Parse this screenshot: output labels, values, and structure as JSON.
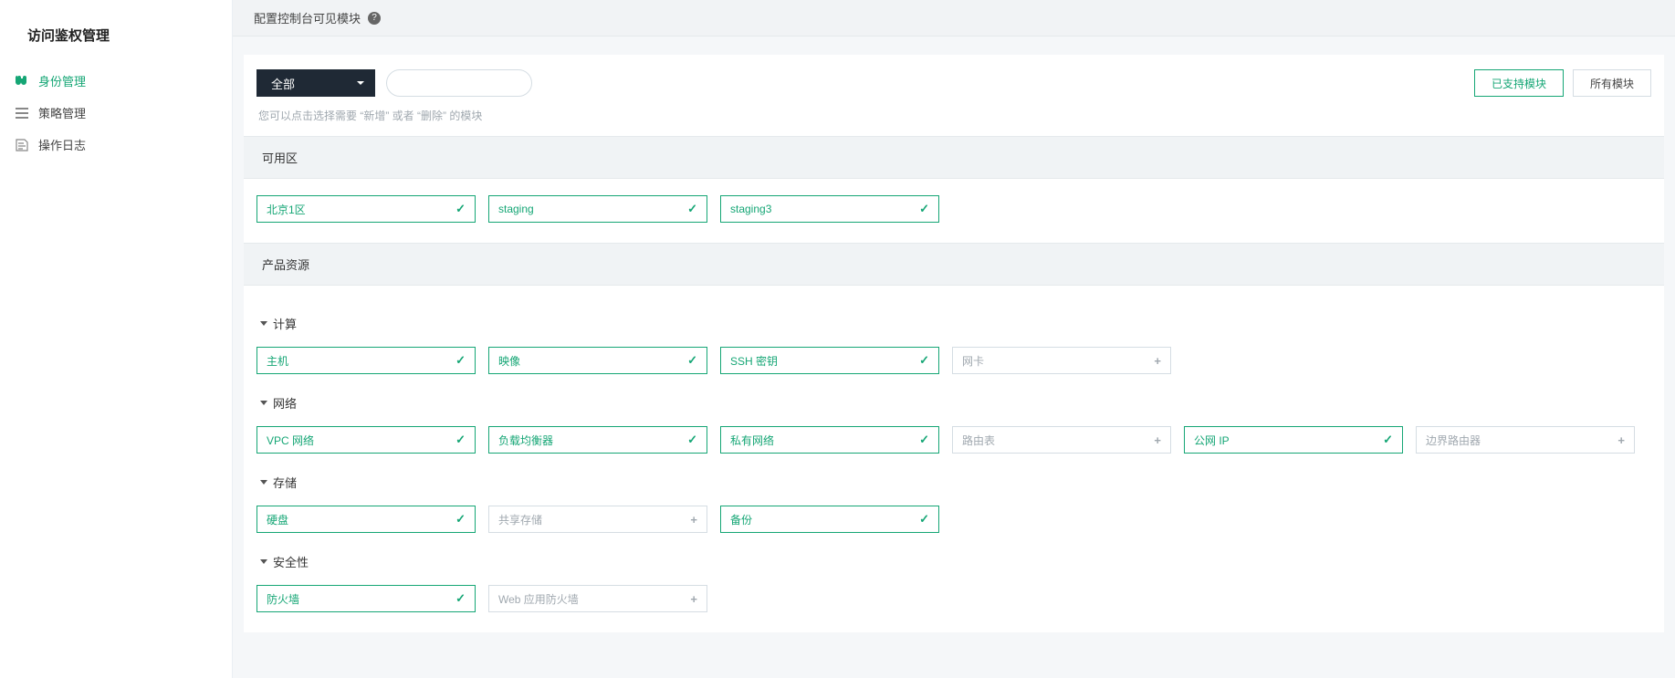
{
  "sidebar": {
    "title": "访问鉴权管理",
    "items": [
      {
        "label": "身份管理",
        "icon": "binoculars",
        "active": true
      },
      {
        "label": "策略管理",
        "icon": "list",
        "active": false
      },
      {
        "label": "操作日志",
        "icon": "log",
        "active": false
      }
    ]
  },
  "header": {
    "title": "配置控制台可见模块"
  },
  "toolbar": {
    "dropdown_label": "全部",
    "supported_button": "已支持模块",
    "all_button": "所有模块",
    "hint": "您可以点击选择需要 “新增” 或者 “删除” 的模块"
  },
  "sections": [
    {
      "title": "可用区",
      "groups": [
        {
          "title": null,
          "chips": [
            {
              "label": "北京1区",
              "state": "check"
            },
            {
              "label": "staging",
              "state": "check"
            },
            {
              "label": "staging3",
              "state": "check"
            }
          ]
        }
      ]
    },
    {
      "title": "产品资源",
      "groups": [
        {
          "title": "计算",
          "chips": [
            {
              "label": "主机",
              "state": "check"
            },
            {
              "label": "映像",
              "state": "check"
            },
            {
              "label": "SSH 密钥",
              "state": "check"
            },
            {
              "label": "网卡",
              "state": "plus"
            }
          ]
        },
        {
          "title": "网络",
          "chips": [
            {
              "label": "VPC 网络",
              "state": "check"
            },
            {
              "label": "负载均衡器",
              "state": "check"
            },
            {
              "label": "私有网络",
              "state": "check"
            },
            {
              "label": "路由表",
              "state": "plus"
            },
            {
              "label": "公网 IP",
              "state": "check"
            },
            {
              "label": "边界路由器",
              "state": "plus"
            }
          ]
        },
        {
          "title": "存储",
          "chips": [
            {
              "label": "硬盘",
              "state": "check"
            },
            {
              "label": "共享存储",
              "state": "plus"
            },
            {
              "label": "备份",
              "state": "check"
            }
          ]
        },
        {
          "title": "安全性",
          "chips": [
            {
              "label": "防火墙",
              "state": "check"
            },
            {
              "label": "Web 应用防火墙",
              "state": "plus"
            }
          ]
        }
      ]
    }
  ]
}
